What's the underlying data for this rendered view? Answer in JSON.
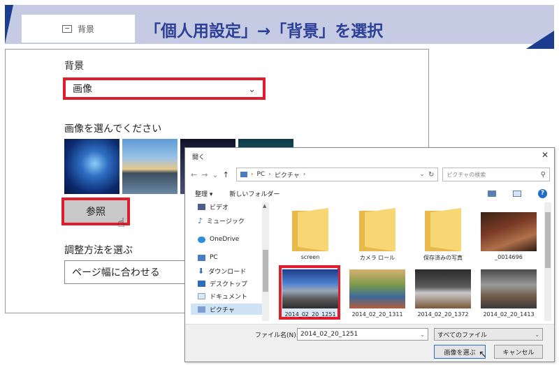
{
  "banner": {
    "chip_label": "背景",
    "title": "「個人用設定」→「背景」を選択"
  },
  "settings": {
    "background_label": "背景",
    "background_value": "画像",
    "choose_image_label": "画像を選んでください",
    "browse_label": "参照",
    "fit_label": "調整方法を選ぶ",
    "fit_value": "ページ幅に合わせる"
  },
  "dialog": {
    "title": "開く",
    "address": {
      "path_pc": "PC",
      "path_folder": "ピクチャ"
    },
    "search_placeholder": "ピクチャの検索",
    "toolbar": {
      "organize": "整理 ▾",
      "new_folder": "新しいフォルダー"
    },
    "sidebar": [
      {
        "label": "ビデオ",
        "icon": "video-icon"
      },
      {
        "label": "ミュージック",
        "icon": "music-icon"
      },
      {
        "label": "OneDrive",
        "icon": "cloud-icon"
      },
      {
        "label": "PC",
        "icon": "pc-icon"
      },
      {
        "label": "ダウンロード",
        "icon": "download-icon"
      },
      {
        "label": "デスクトップ",
        "icon": "desktop-icon"
      },
      {
        "label": "ドキュメント",
        "icon": "document-icon"
      },
      {
        "label": "ピクチャ",
        "icon": "pictures-icon",
        "selected": true
      }
    ],
    "files": [
      {
        "name": "screen",
        "kind": "folder"
      },
      {
        "name": "カメラ ロール",
        "kind": "folder"
      },
      {
        "name": "保存済みの写真",
        "kind": "folder"
      },
      {
        "name": "_0014696",
        "kind": "photo"
      },
      {
        "name": "2014_02_20_1251",
        "kind": "photo",
        "selected": true
      },
      {
        "name": "2014_02_20_1311",
        "kind": "photo"
      },
      {
        "name": "2014_02_20_1372",
        "kind": "photo"
      },
      {
        "name": "2014_02_20_1413",
        "kind": "photo"
      }
    ],
    "filename_label": "ファイル名(N):",
    "filename_value": "2014_02_20_1251",
    "filetype_value": "すべてのファイル",
    "choose_button": "画像を選ぶ",
    "cancel_button": "キャンセル"
  },
  "colors": {
    "highlight_red": "#e01d2a",
    "banner_bg": "#c5cbe3",
    "banner_text": "#2b3f96"
  }
}
